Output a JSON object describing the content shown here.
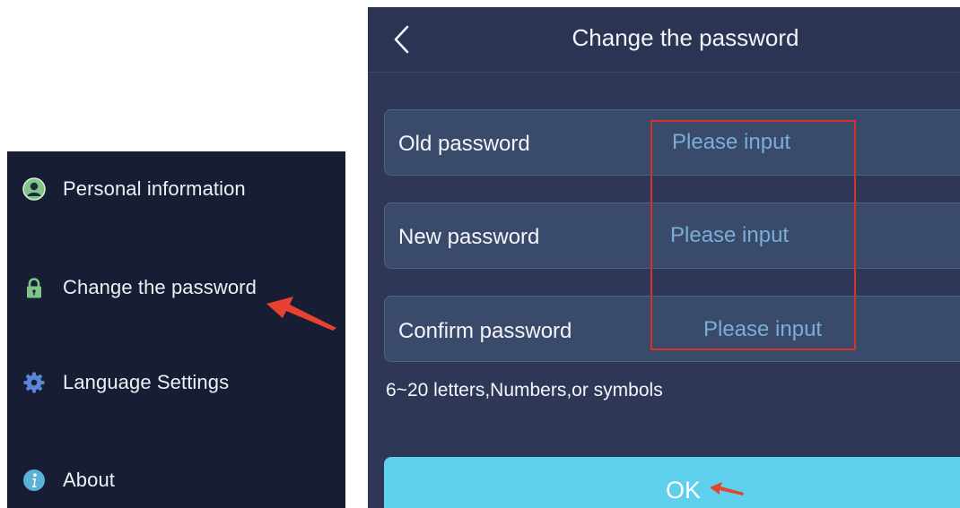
{
  "menu": {
    "items": [
      {
        "label": "Personal information",
        "icon": "person-icon"
      },
      {
        "label": "Change the password",
        "icon": "lock-icon"
      },
      {
        "label": "Language Settings",
        "icon": "gear-icon"
      },
      {
        "label": "About",
        "icon": "info-icon"
      }
    ]
  },
  "header": {
    "title": "Change the password",
    "back_icon": "chevron-left-icon"
  },
  "form": {
    "fields": [
      {
        "label": "Old password",
        "placeholder": "Please input",
        "value": ""
      },
      {
        "label": "New password",
        "placeholder": "Please input",
        "value": ""
      },
      {
        "label": "Confirm password",
        "placeholder": "Please input",
        "value": ""
      }
    ],
    "hint": "6~20 letters,Numbers,or symbols",
    "ok_label": "OK"
  },
  "colors": {
    "menu_background": "#171d33",
    "panel_background": "#2e3856",
    "field_background": "#3a4a6b",
    "placeholder": "#79aed7",
    "button": "#5fcfee",
    "annotation": "#d9302e"
  }
}
